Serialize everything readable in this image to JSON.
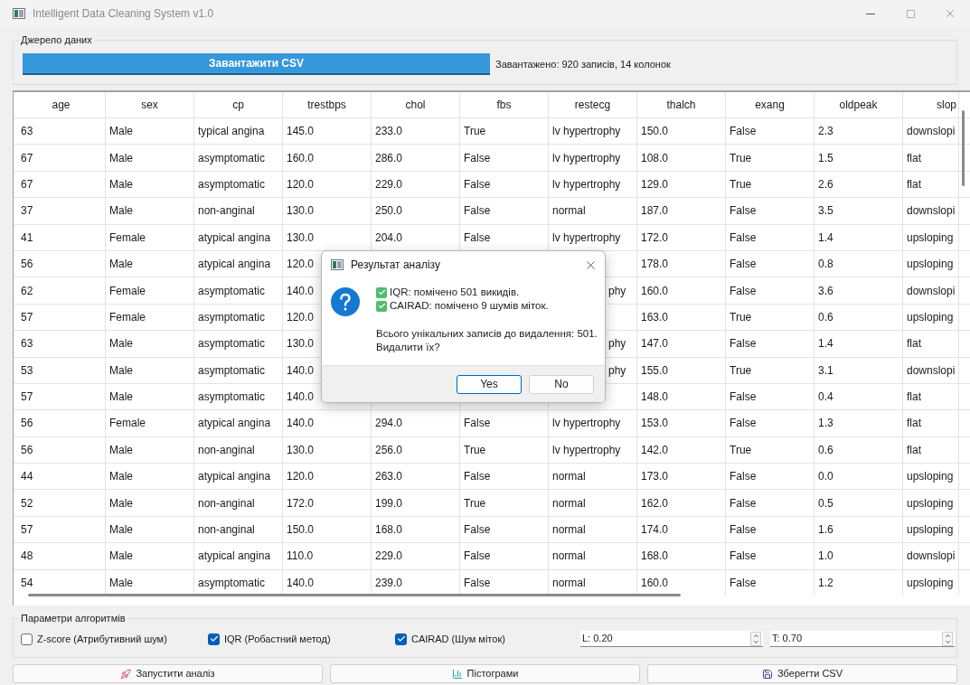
{
  "window": {
    "title": "Intelligent Data Cleaning System v1.0"
  },
  "source_group": {
    "title": "Джерело даних",
    "load_button": "Завантажити CSV",
    "status": "Завантажено: 920 записів, 14 колонок"
  },
  "table": {
    "columns": [
      "age",
      "sex",
      "cp",
      "trestbps",
      "chol",
      "fbs",
      "restecg",
      "thalch",
      "exang",
      "oldpeak",
      "slop"
    ],
    "rows": [
      {
        "cells": [
          "63",
          "Male",
          "typical angina",
          "145.0",
          "233.0",
          "True",
          "lv hypertrophy",
          "150.0",
          "False",
          "2.3",
          "downslopi"
        ]
      },
      {
        "cells": [
          "67",
          "Male",
          "asymptomatic",
          "160.0",
          "286.0",
          "False",
          "lv hypertrophy",
          "108.0",
          "True",
          "1.5",
          "flat"
        ]
      },
      {
        "cells": [
          "67",
          "Male",
          "asymptomatic",
          "120.0",
          "229.0",
          "False",
          "lv hypertrophy",
          "129.0",
          "True",
          "2.6",
          "flat"
        ]
      },
      {
        "cells": [
          "37",
          "Male",
          "non-anginal",
          "130.0",
          "250.0",
          "False",
          "normal",
          "187.0",
          "False",
          "3.5",
          "downslopi"
        ]
      },
      {
        "cells": [
          "41",
          "Female",
          "atypical angina",
          "130.0",
          "204.0",
          "False",
          "lv hypertrophy",
          "172.0",
          "False",
          "1.4",
          "upsloping"
        ]
      },
      {
        "cells": [
          "56",
          "Male",
          "atypical angina",
          "120.0",
          null,
          null,
          null,
          "178.0",
          "False",
          "0.8",
          "upsloping"
        ]
      },
      {
        "cells": [
          "62",
          "Female",
          "asymptomatic",
          "140.0",
          null,
          null,
          "phy",
          "160.0",
          "False",
          "3.6",
          "downslopi"
        ]
      },
      {
        "cells": [
          "57",
          "Female",
          "asymptomatic",
          "120.0",
          null,
          null,
          null,
          "163.0",
          "True",
          "0.6",
          "upsloping"
        ]
      },
      {
        "cells": [
          "63",
          "Male",
          "asymptomatic",
          "130.0",
          null,
          null,
          "phy",
          "147.0",
          "False",
          "1.4",
          "flat"
        ]
      },
      {
        "cells": [
          "53",
          "Male",
          "asymptomatic",
          "140.0",
          null,
          null,
          "phy",
          "155.0",
          "True",
          "3.1",
          "downslopi"
        ]
      },
      {
        "cells": [
          "57",
          "Male",
          "asymptomatic",
          "140.0",
          null,
          null,
          null,
          "148.0",
          "False",
          "0.4",
          "flat"
        ]
      },
      {
        "cells": [
          "56",
          "Female",
          "atypical angina",
          "140.0",
          "294.0",
          "False",
          "lv hypertrophy",
          "153.0",
          "False",
          "1.3",
          "flat"
        ]
      },
      {
        "cells": [
          "56",
          "Male",
          "non-anginal",
          "130.0",
          "256.0",
          "True",
          "lv hypertrophy",
          "142.0",
          "True",
          "0.6",
          "flat"
        ]
      },
      {
        "cells": [
          "44",
          "Male",
          "atypical angina",
          "120.0",
          "263.0",
          "False",
          "normal",
          "173.0",
          "False",
          "0.0",
          "upsloping"
        ]
      },
      {
        "cells": [
          "52",
          "Male",
          "non-anginal",
          "172.0",
          "199.0",
          "True",
          "normal",
          "162.0",
          "False",
          "0.5",
          "upsloping"
        ]
      },
      {
        "cells": [
          "57",
          "Male",
          "non-anginal",
          "150.0",
          "168.0",
          "False",
          "normal",
          "174.0",
          "False",
          "1.6",
          "upsloping"
        ]
      },
      {
        "cells": [
          "48",
          "Male",
          "atypical angina",
          "110.0",
          "229.0",
          "False",
          "normal",
          "168.0",
          "False",
          "1.0",
          "downslopi"
        ]
      },
      {
        "cells": [
          "54",
          "Male",
          "asymptomatic",
          "140.0",
          "239.0",
          "False",
          "normal",
          "160.0",
          "False",
          "1.2",
          "upsloping"
        ]
      }
    ]
  },
  "params_group": {
    "title": "Параметри алгоритмів",
    "checkboxes": [
      {
        "label": "Z-score (Атрибутивний шум)",
        "checked": false
      },
      {
        "label": "IQR (Робастний метод)",
        "checked": true
      },
      {
        "label": "CAIRAD (Шум міток)",
        "checked": true
      }
    ],
    "spinboxes": [
      "L: 0.20",
      "T: 0.70"
    ]
  },
  "actions": [
    {
      "kind": "run",
      "label": "Запустити аналіз"
    },
    {
      "kind": "histograms",
      "label": "Пістограми"
    },
    {
      "kind": "save",
      "label": "Зберегти CSV"
    }
  ],
  "dialog": {
    "title": "Результат аналізу",
    "findings": [
      "IQR: помічено 501 викидів.",
      "CAIRAD: помічено 9 шумів міток."
    ],
    "message": "Всього унікальних записів до видалення: 501.",
    "question": "Видалити їх?",
    "buttons": [
      {
        "label": "Yes",
        "selected": true
      },
      {
        "label": "No",
        "selected": false
      }
    ]
  }
}
